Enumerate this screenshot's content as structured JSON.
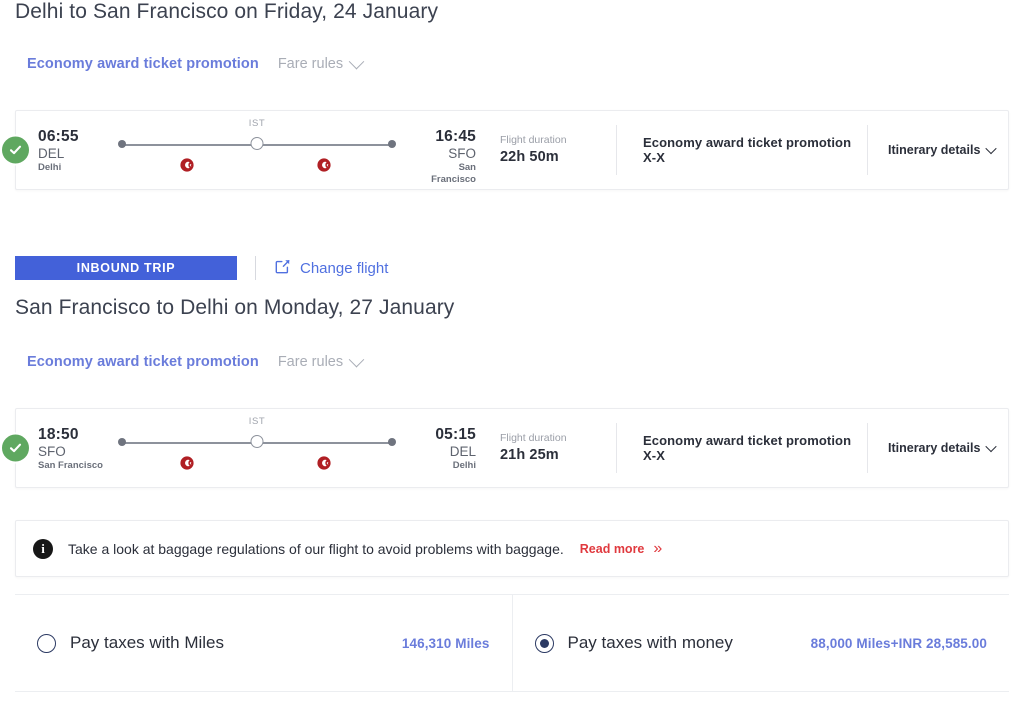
{
  "outbound": {
    "title": "Delhi to San Francisco on Friday, 24 January",
    "fare_name": "Economy award ticket promotion",
    "fare_rules_label": "Fare rules",
    "flight": {
      "depart_time": "06:55",
      "depart_code": "DEL",
      "depart_city": "Delhi",
      "arrive_time": "16:45",
      "arrive_code": "SFO",
      "arrive_city": "San\nFrancisco",
      "arrive_city_line1": "San",
      "arrive_city_line2": "Francisco",
      "stop_label": "IST",
      "duration_label": "Flight duration",
      "duration_value": "22h 50m",
      "promotion": "Economy award ticket promotion X-X",
      "itinerary_label": "Itinerary details"
    }
  },
  "inbound": {
    "badge": "INBOUND TRIP",
    "change_flight": "Change flight",
    "title": "San Francisco to Delhi on Monday, 27 January",
    "fare_name": "Economy award ticket promotion",
    "fare_rules_label": "Fare rules",
    "flight": {
      "depart_time": "18:50",
      "depart_code": "SFO",
      "depart_city": "San Francisco",
      "arrive_time": "05:15",
      "arrive_code": "DEL",
      "arrive_city": "Delhi",
      "stop_label": "IST",
      "duration_label": "Flight duration",
      "duration_value": "21h 25m",
      "promotion": "Economy award ticket promotion X-X",
      "itinerary_label": "Itinerary details"
    }
  },
  "baggage_notice": {
    "text": "Take a look at baggage regulations of our flight to avoid problems with baggage.",
    "read_more": "Read more"
  },
  "payment": {
    "options": [
      {
        "label": "Pay taxes with Miles",
        "amount": "146,310 Miles",
        "selected": false
      },
      {
        "label": "Pay taxes with money",
        "amount": "88,000 Miles+INR 28,585.00",
        "selected": true
      }
    ]
  },
  "colors": {
    "fare_link": "#6a7cdb",
    "inbound_badge": "#4361d9",
    "change_flight_link": "#5070e0",
    "read_more": "#e0393e",
    "check_badge": "#5fa860",
    "radio": "#2c3a63",
    "carrier_logo": "#b01f24"
  }
}
